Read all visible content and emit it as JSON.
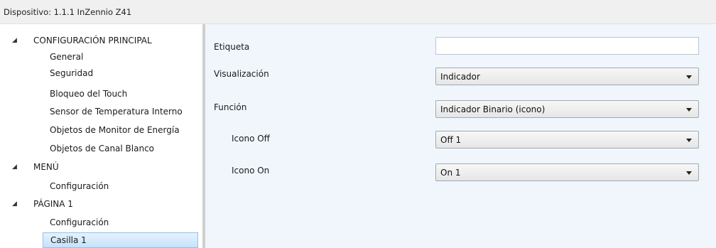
{
  "window": {
    "title": "Dispositivo: 1.1.1  InZennio Z41"
  },
  "tree": {
    "g1": "CONFIGURACIÓN PRINCIPAL",
    "g1_items": [
      "General",
      "Seguridad",
      "Bloqueo del Touch",
      "Sensor de Temperatura Interno",
      "Objetos de Monitor de Energía",
      "Objetos de Canal Blanco"
    ],
    "g2": "MENÚ",
    "g2_items": [
      "Configuración"
    ],
    "g3": "PÁGINA 1",
    "g3_items": [
      "Configuración",
      "Casilla 1"
    ],
    "expand_glyph": "◢"
  },
  "params": {
    "etiqueta": {
      "label": "Etiqueta",
      "value": ""
    },
    "visualizacion": {
      "label": "Visualización",
      "value": "Indicador"
    },
    "funcion": {
      "label": "Función",
      "value": "Indicador Binario (icono)"
    },
    "icono_off": {
      "label": "Icono Off",
      "value": "Off 1"
    },
    "icono_on": {
      "label": "Icono On",
      "value": "On 1"
    }
  }
}
